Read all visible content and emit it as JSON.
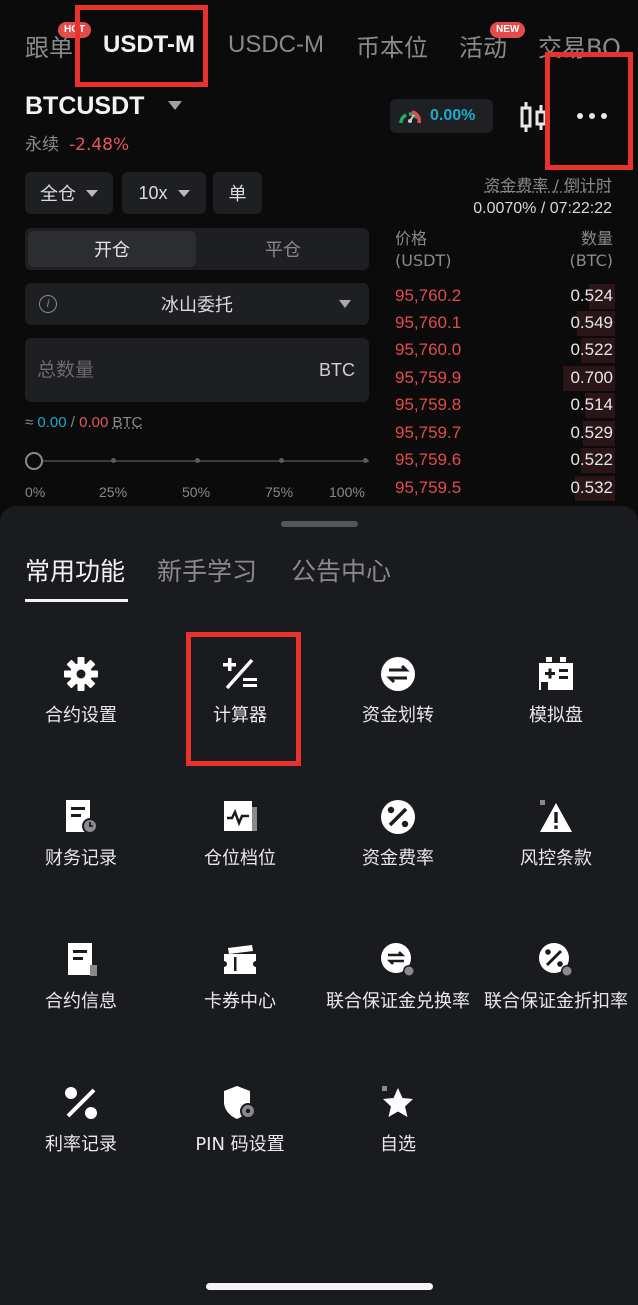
{
  "top_tabs": [
    {
      "label": "跟单",
      "badge": "HOT",
      "active": false
    },
    {
      "label": "USDT-M",
      "active": true
    },
    {
      "label": "USDC-M",
      "active": false
    },
    {
      "label": "币本位",
      "active": false
    },
    {
      "label": "活动",
      "badge": "NEW",
      "active": false
    },
    {
      "label": "交易BO",
      "active": false
    }
  ],
  "symbol": {
    "name": "BTCUSDT",
    "type": "永续",
    "change": "-2.48%"
  },
  "pnl_gauge": {
    "value": "0.00%"
  },
  "order_form": {
    "margin_mode": "全仓",
    "leverage": "10x",
    "position_mode": "单",
    "funding_label": "资金费率 / 倒计时",
    "funding_value": "0.0070% / 07:22:22",
    "open_label": "开仓",
    "close_label": "平仓",
    "order_type": "冰山委托",
    "quantity_placeholder": "总数量",
    "quantity_unit": "BTC",
    "approx_prefix": "≈",
    "approx_buy": "0.00",
    "approx_sep": "/",
    "approx_sell": "0.00",
    "approx_unit": "BTC",
    "slider_value_percent": 0,
    "slider_marks": [
      "0%",
      "25%",
      "50%",
      "75%",
      "100%"
    ]
  },
  "order_book": {
    "price_header": "价格",
    "price_unit": "(USDT)",
    "qty_header": "数量",
    "qty_unit": "(BTC)",
    "asks": [
      {
        "price": "95,760.2",
        "qty": "0.524"
      },
      {
        "price": "95,760.1",
        "qty": "0.549"
      },
      {
        "price": "95,760.0",
        "qty": "0.522"
      },
      {
        "price": "95,759.9",
        "qty": "0.700"
      },
      {
        "price": "95,759.8",
        "qty": "0.514"
      },
      {
        "price": "95,759.7",
        "qty": "0.529"
      },
      {
        "price": "95,759.6",
        "qty": "0.522"
      },
      {
        "price": "95,759.5",
        "qty": "0.532"
      }
    ]
  },
  "sheet": {
    "tabs": [
      "常用功能",
      "新手学习",
      "公告中心"
    ],
    "items": [
      {
        "label": "合约设置",
        "icon": "gear-icon"
      },
      {
        "label": "计算器",
        "icon": "calculator-icon"
      },
      {
        "label": "资金划转",
        "icon": "transfer-icon"
      },
      {
        "label": "模拟盘",
        "icon": "demo-trading-icon"
      },
      {
        "label": "财务记录",
        "icon": "financial-record-icon"
      },
      {
        "label": "仓位档位",
        "icon": "position-tier-icon"
      },
      {
        "label": "资金费率",
        "icon": "funding-rate-icon"
      },
      {
        "label": "风控条款",
        "icon": "warning-icon"
      },
      {
        "label": "合约信息",
        "icon": "contract-info-icon"
      },
      {
        "label": "卡券中心",
        "icon": "coupon-icon"
      },
      {
        "label": "联合保证金兑换率",
        "icon": "margin-exchange-icon"
      },
      {
        "label": "联合保证金折扣率",
        "icon": "margin-discount-icon"
      },
      {
        "label": "利率记录",
        "icon": "interest-rate-icon"
      },
      {
        "label": "PIN 码设置",
        "icon": "pin-settings-icon"
      },
      {
        "label": "自选",
        "icon": "star-icon"
      }
    ]
  },
  "colors": {
    "highlight": "#e8322d",
    "ask_red": "#e24c4b",
    "accent_cyan": "#1fa9c9",
    "sheet_bg": "#1a1b1e"
  }
}
